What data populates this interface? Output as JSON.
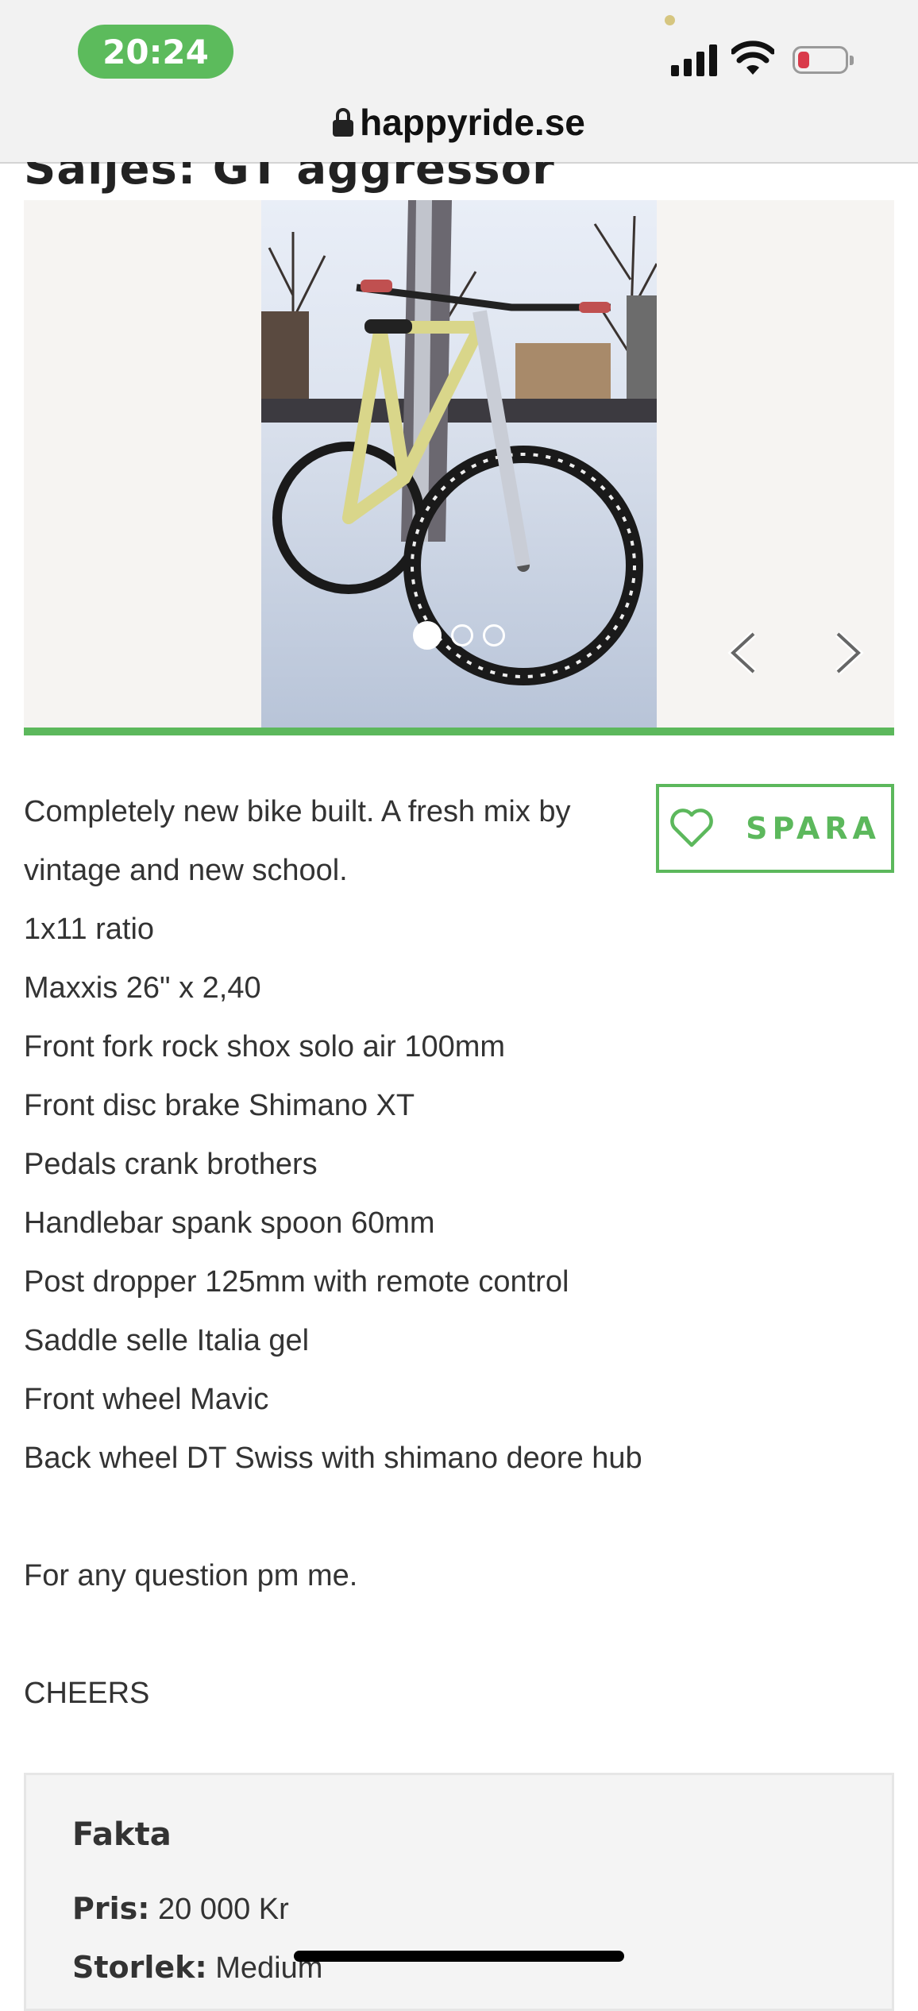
{
  "status_bar": {
    "time": "20:24"
  },
  "browser": {
    "url": "happyride.se"
  },
  "listing": {
    "title_partial": "Saljes: GT aggressor",
    "gallery": {
      "slide_count": 3,
      "active_slide": 1
    },
    "description": {
      "first_line": "Completely new bike built. A fresh mix by vintage and new school.",
      "lines": [
        "1x11 ratio",
        "Maxxis 26\" x 2,40",
        "Front fork rock shox solo air 100mm",
        "Front disc brake Shimano XT",
        "Pedals crank brothers",
        "Handlebar spank spoon 60mm",
        "Post dropper 125mm with remote control",
        "Saddle selle Italia gel",
        "Front wheel Mavic",
        "Back wheel DT Swiss with shimano deore hub"
      ],
      "question_line": "For any question pm me.",
      "closing": "CHEERS"
    },
    "save_button": {
      "label": "SPARA",
      "icon": "heart-outline-icon"
    },
    "facts": {
      "heading": "Fakta",
      "price_label": "Pris:",
      "price_value": "20 000 Kr",
      "size_label": "Storlek:",
      "size_value": "Medium"
    }
  },
  "colors": {
    "brand_green": "#5cb85c",
    "time_pill": "#5cbb5c",
    "battery_low": "#d93a4a"
  }
}
